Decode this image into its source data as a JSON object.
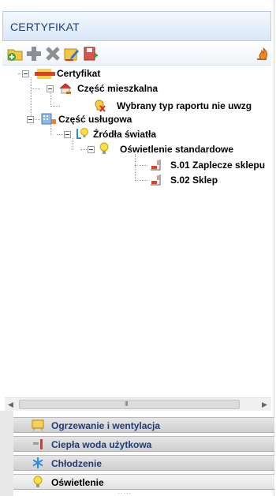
{
  "header": {
    "title": "CERTYFIKAT"
  },
  "toolbar": {
    "buttons": [
      {
        "icon": "add-folder-icon"
      },
      {
        "icon": "plus-icon"
      },
      {
        "icon": "delete-x-icon"
      },
      {
        "icon": "edit-icon"
      },
      {
        "icon": "save-icon"
      }
    ],
    "right_icon": "fire-icon"
  },
  "tree": {
    "root": "Certyfikat",
    "residential": "Część mieszkalna",
    "warning": "Wybrany typ raportu nie uwzg",
    "service": "Część usługowa",
    "light_sources": "Źródła światła",
    "standard_lighting": "Oświetlenie standardowe",
    "room1": "S.01 Zaplecze sklepu",
    "room2": "S.02 Sklep"
  },
  "scrollbar": {
    "grip": "III"
  },
  "nav": {
    "heating": "Ogrzewanie i wentylacja",
    "hot_water": "Ciepła woda użytkowa",
    "cooling": "Chłodzenie",
    "lighting": "Oświetlenie"
  },
  "colors": {
    "accent": "#1f3c77",
    "title_text": "#1c3f7a"
  }
}
